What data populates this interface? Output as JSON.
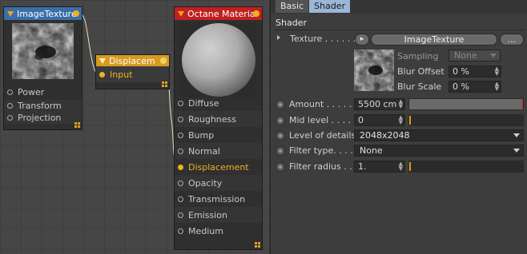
{
  "nodes": {
    "image_texture": {
      "title": "ImageTexture",
      "ports": [
        "Power",
        "Transform",
        "Projection"
      ]
    },
    "displacement": {
      "title": "Displacem",
      "ports": [
        "Input"
      ]
    },
    "octane_material": {
      "title": "Octane Material",
      "ports": [
        "Diffuse",
        "Roughness",
        "Bump",
        "Normal",
        "Displacement",
        "Opacity",
        "Transmission",
        "Emission",
        "Medium"
      ],
      "active_port": "Displacement"
    }
  },
  "colors": {
    "accent": "#f0b020",
    "header_blue": "#3a6ea8",
    "header_red": "#c02020",
    "tab_active": "#9ab6d8"
  },
  "panel": {
    "tabs": [
      {
        "label": "Basic",
        "active": false
      },
      {
        "label": "Shader",
        "active": true
      }
    ],
    "section_title": "Shader",
    "texture": {
      "label": "Texture . . . . . .",
      "arrow_button": "▸",
      "value_button": "ImageTexture",
      "more_button": "..."
    },
    "sampling": {
      "label": "Sampling",
      "value": "None"
    },
    "blur_offset": {
      "label": "Blur Offset",
      "value": "0 %"
    },
    "blur_scale": {
      "label": "Blur Scale",
      "value": "0 %"
    },
    "amount": {
      "label": "Amount . . . . . .",
      "value": "5500 cm",
      "fraction": 1.0
    },
    "mid_level": {
      "label": "Mid level . . . . .",
      "value": "0",
      "fraction": 0.0
    },
    "level_of_details": {
      "label": "Level of details",
      "value": "2048x2048"
    },
    "filter_type": {
      "label": "Filter type. . . .",
      "value": "None"
    },
    "filter_radius": {
      "label": "Filter radius . .",
      "value": "1.",
      "fraction": 0.0
    }
  }
}
